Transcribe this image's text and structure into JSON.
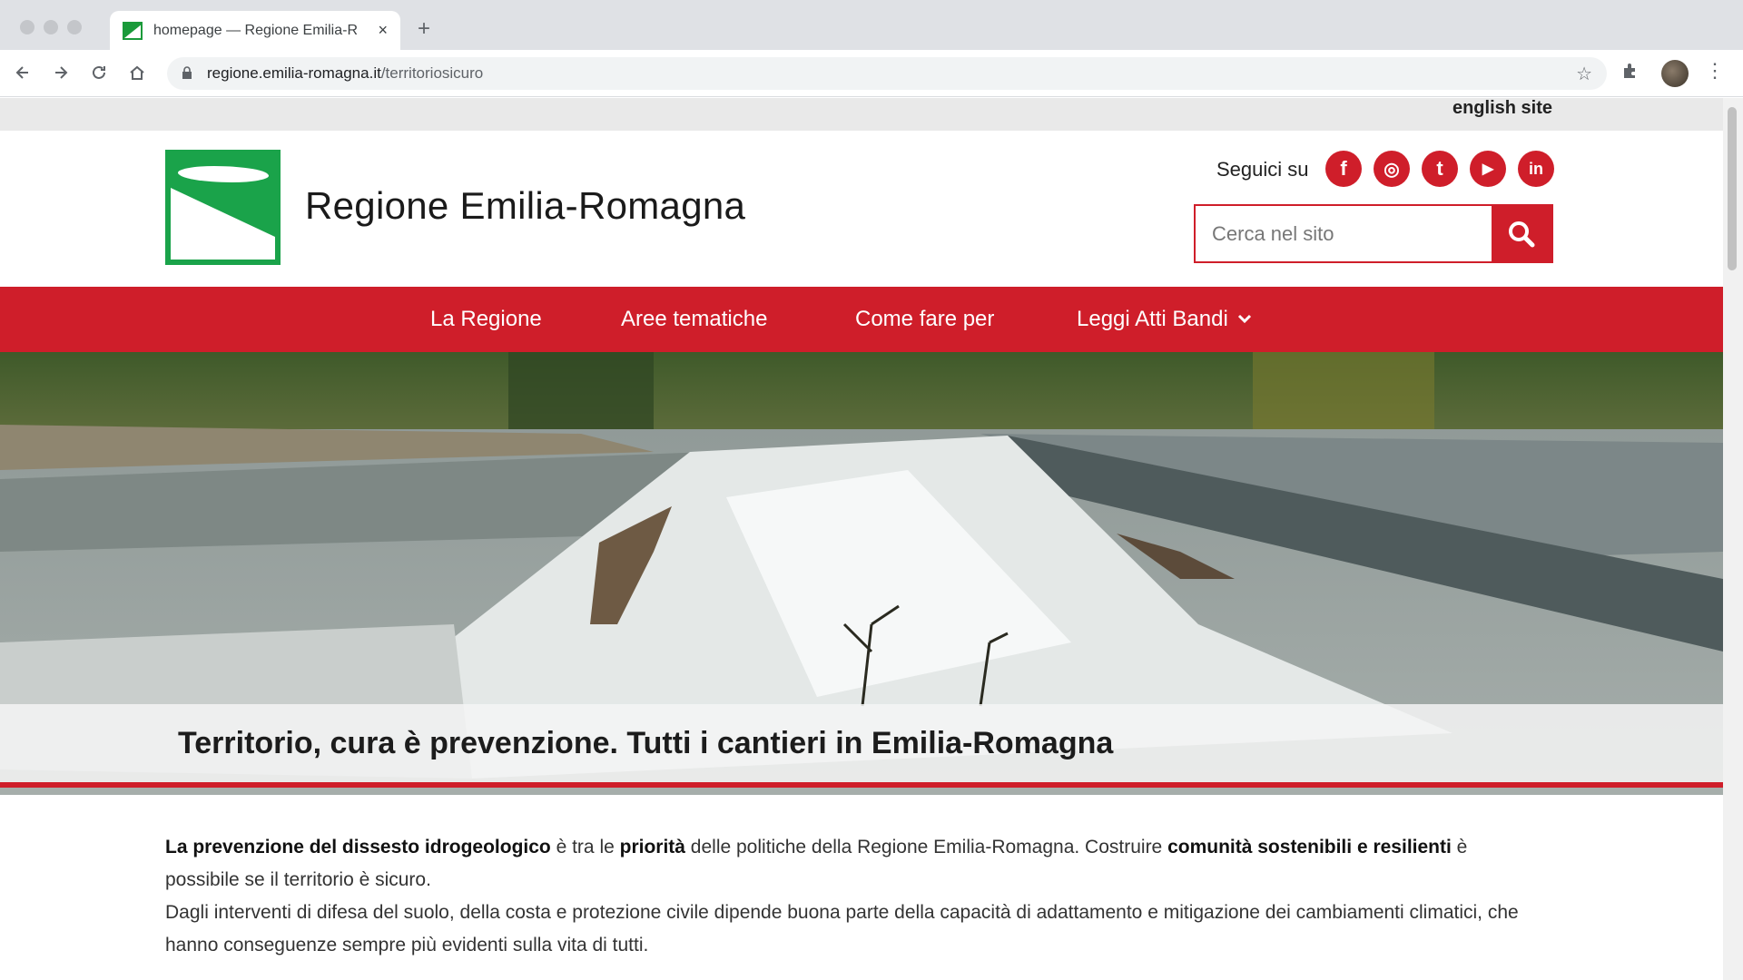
{
  "browser": {
    "tab_title": "homepage — Regione Emilia-R",
    "tab_close": "×",
    "new_tab": "+",
    "url_host": "regione.emilia-romagna.it",
    "url_path": "/territoriosicuro",
    "icons": [
      "back-icon",
      "forward-icon",
      "reload-icon",
      "home-icon",
      "lock-icon",
      "star-icon",
      "extensions-icon",
      "menu-icon"
    ]
  },
  "header": {
    "english_link": "english site",
    "site_title": "Regione Emilia-Romagna",
    "follow_label": "Seguici su",
    "social": [
      {
        "name": "facebook",
        "glyph": "f"
      },
      {
        "name": "instagram",
        "glyph": "◎"
      },
      {
        "name": "twitter",
        "glyph": "t"
      },
      {
        "name": "youtube",
        "glyph": "▶"
      },
      {
        "name": "linkedin",
        "glyph": "in"
      }
    ],
    "search_placeholder": "Cerca nel sito"
  },
  "nav": {
    "items": [
      "La Regione",
      "Aree tematiche",
      "Come fare per",
      "Leggi Atti Bandi"
    ]
  },
  "hero": {
    "title": "Territorio, cura è prevenzione. Tutti i cantieri in Emilia-Romagna"
  },
  "intro": {
    "p1_a": "La prevenzione del dissesto idrogeologico",
    "p1_b": " è tra le ",
    "p1_c": "priorità",
    "p1_d": " delle politiche della Regione Emilia-Romagna. Costruire ",
    "p1_e": "comunità sostenibili e resilienti",
    "p1_f": " è possibile se il territorio è sicuro.",
    "p2": "Dagli interventi di difesa del suolo, della costa e protezione civile dipende buona parte della capacità di adattamento e mitigazione dei cambiamenti climatici, che hanno conseguenze sempre più evidenti sulla vita di tutti."
  },
  "colors": {
    "brand_red": "#cf1e2a",
    "brand_green": "#1aa34a"
  }
}
